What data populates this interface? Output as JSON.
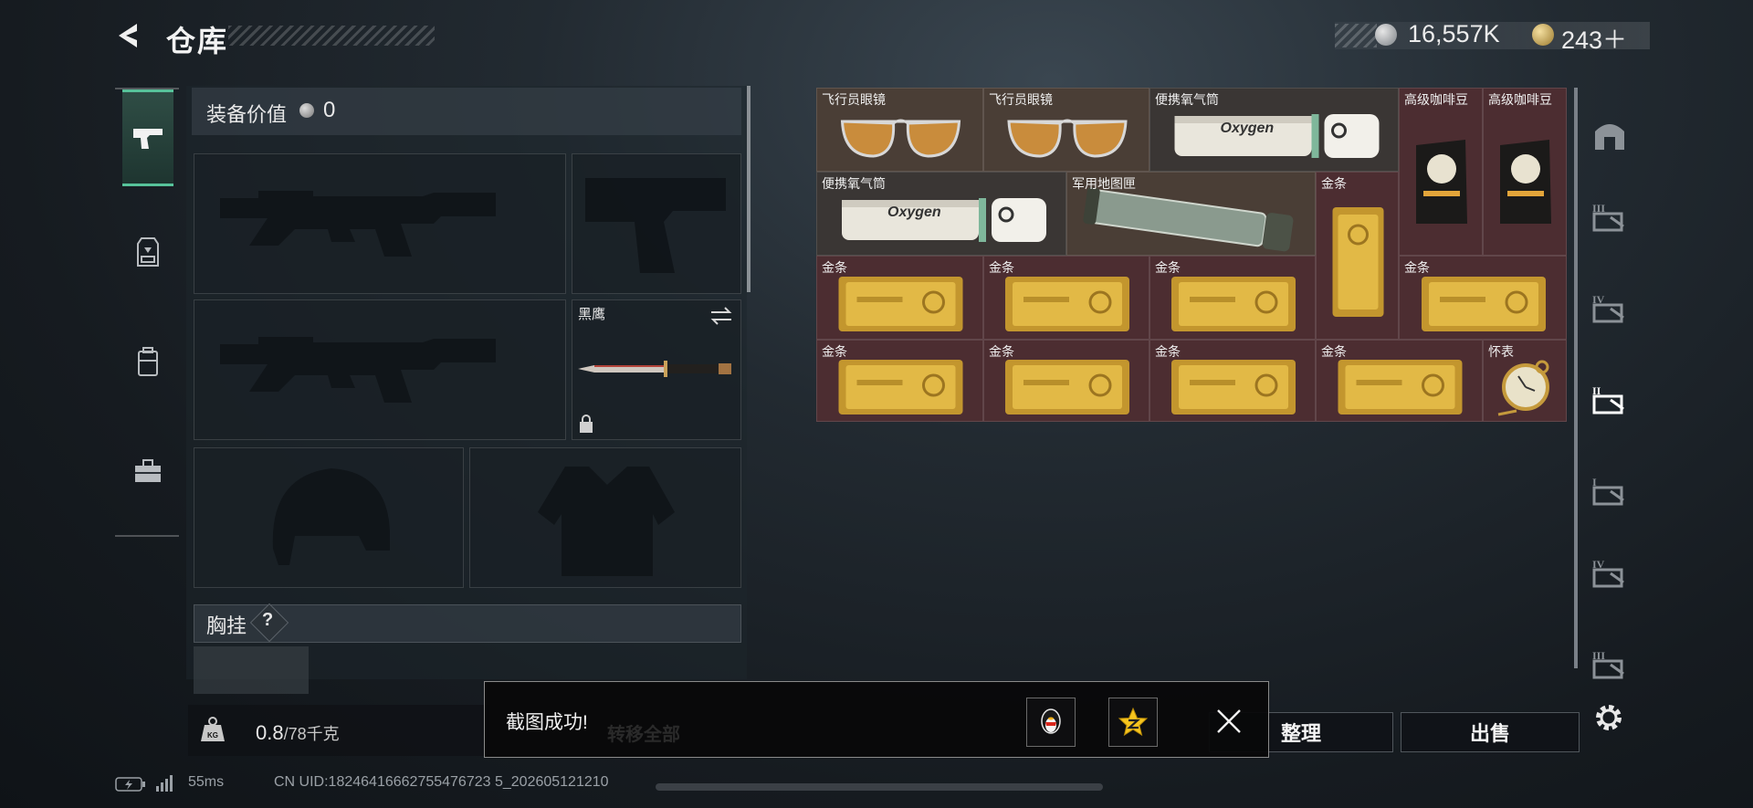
{
  "header": {
    "title": "仓库",
    "silver_amount": "16,557K",
    "gold_amount": "243＋"
  },
  "left_tabs": [
    {
      "name": "weapons",
      "active": true
    },
    {
      "name": "vest",
      "active": false
    },
    {
      "name": "backpack",
      "active": false
    },
    {
      "name": "case",
      "active": false
    }
  ],
  "equipment": {
    "value_label": "装备价值",
    "value": "0",
    "knife_label": "黑鹰",
    "chest_label": "胸挂",
    "chest_help": "?"
  },
  "weight": {
    "current": "0.8",
    "max": "/78千克",
    "icon_text": "KG"
  },
  "inventory": {
    "items": [
      {
        "label": "飞行员眼镜",
        "kind": "sunglasses",
        "rarity": "brown"
      },
      {
        "label": "飞行员眼镜",
        "kind": "sunglasses",
        "rarity": "brown"
      },
      {
        "label": "便携氧气筒",
        "kind": "oxygen",
        "rarity": "sil"
      },
      {
        "label": "高级咖啡豆",
        "kind": "coffee",
        "rarity": "gold"
      },
      {
        "label": "高级咖啡豆",
        "kind": "coffee",
        "rarity": "gold"
      },
      {
        "label": "便携氧气筒",
        "kind": "oxygen",
        "rarity": "sil"
      },
      {
        "label": "军用地图匣",
        "kind": "tube",
        "rarity": "brown"
      },
      {
        "label": "金条",
        "kind": "goldbar-v",
        "rarity": "gold"
      },
      {
        "label": "金条",
        "kind": "goldbar",
        "rarity": "gold"
      },
      {
        "label": "金条",
        "kind": "goldbar",
        "rarity": "gold"
      },
      {
        "label": "金条",
        "kind": "goldbar",
        "rarity": "gold"
      },
      {
        "label": "金条",
        "kind": "goldbar",
        "rarity": "gold"
      },
      {
        "label": "金条",
        "kind": "goldbar",
        "rarity": "gold"
      },
      {
        "label": "金条",
        "kind": "goldbar",
        "rarity": "gold"
      },
      {
        "label": "金条",
        "kind": "goldbar",
        "rarity": "gold"
      },
      {
        "label": "金条",
        "kind": "goldbar",
        "rarity": "gold"
      },
      {
        "label": "怀表",
        "kind": "watch",
        "rarity": "gold"
      }
    ]
  },
  "right_tabs": [
    {
      "name": "storage-arch-icon"
    },
    {
      "name": "tier-iii-box-icon",
      "text": "III"
    },
    {
      "name": "tier-iv-box-icon",
      "text": "IV"
    },
    {
      "name": "tier-ii-box-icon",
      "text": "II",
      "active": true
    },
    {
      "name": "tier-i-box-icon",
      "text": "I"
    },
    {
      "name": "tier-iv-box-icon",
      "text": "IV"
    },
    {
      "name": "tier-iii-box-icon",
      "text": "III"
    }
  ],
  "buttons": {
    "transfer_all": "转移全部",
    "sort": "整理",
    "sell": "出售"
  },
  "toast": {
    "message": "截图成功!"
  },
  "status_bar": {
    "ping": "55ms",
    "uid": "CN UID:18246416662755476723 5_202605121210"
  },
  "colors": {
    "gold_cell": "#4c2d31",
    "brown_cell": "#4a3e36",
    "active_tab": "#57c39a"
  }
}
